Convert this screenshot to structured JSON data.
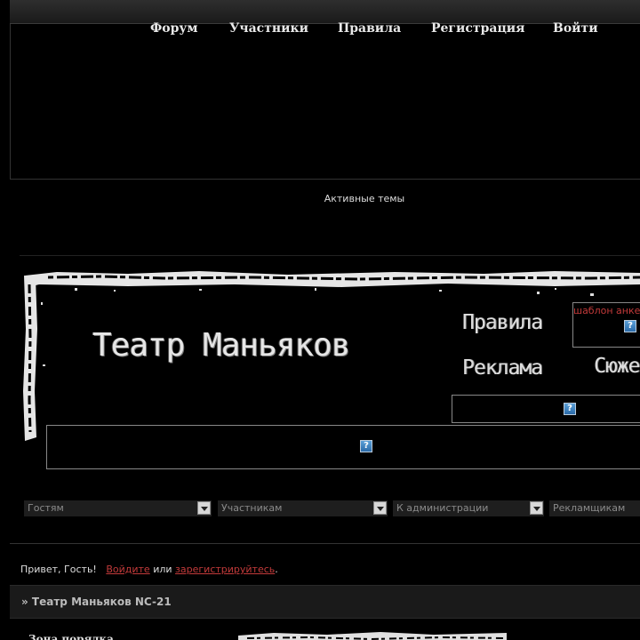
{
  "nav": {
    "items": [
      {
        "label": "Форум"
      },
      {
        "label": "Участники"
      },
      {
        "label": "Правила"
      },
      {
        "label": "Регистрация"
      },
      {
        "label": "Войти"
      }
    ]
  },
  "active_topics": "Активные темы",
  "banner": {
    "logo": "Театр Маньяков",
    "links": {
      "rules": "Правила",
      "ads": "Реклама",
      "plot": "Сюжет"
    },
    "template_link": "шаблон анкеты",
    "help_icon": "?"
  },
  "selects": [
    {
      "value": "Гостям"
    },
    {
      "value": "Участникам"
    },
    {
      "value": "К администрации"
    },
    {
      "value": "Рекламщикам"
    }
  ],
  "greeting": {
    "prefix": "Привет, Гость!",
    "login_link": "Войдите",
    "or": "или",
    "register_link": "зарегистрируйтесь",
    "suffix": "."
  },
  "breadcrumb": "» Театр Маньяков NC-21",
  "section": {
    "title": "Зона порядка"
  },
  "colors": {
    "accent_red": "#c23a3a",
    "background": "#000000",
    "help_icon_blue": "#3a7ec0"
  }
}
